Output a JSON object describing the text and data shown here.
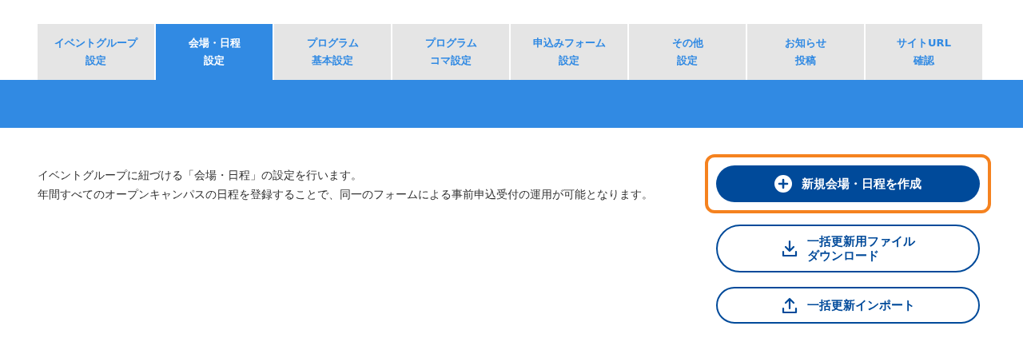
{
  "tabs": [
    {
      "lines": [
        "イベントグループ",
        "設定"
      ],
      "selected": false
    },
    {
      "lines": [
        "会場・日程",
        "設定"
      ],
      "selected": true
    },
    {
      "lines": [
        "プログラム",
        "基本設定"
      ],
      "selected": false
    },
    {
      "lines": [
        "プログラム",
        "コマ設定"
      ],
      "selected": false
    },
    {
      "lines": [
        "申込みフォーム",
        "設定"
      ],
      "selected": false
    },
    {
      "lines": [
        "その他",
        "設定"
      ],
      "selected": false
    },
    {
      "lines": [
        "お知らせ",
        "投稿"
      ],
      "selected": false
    },
    {
      "lines": [
        "サイトURL",
        "確認"
      ],
      "selected": false
    }
  ],
  "description": [
    "イベントグループに紐づける「会場・日程」の設定を行います。",
    "年間すべてのオープンキャンパスの日程を登録することで、同一のフォームによる事前申込受付の運用が可能となります。"
  ],
  "actions": [
    {
      "kind": "create",
      "lines": [
        "新規会場・日程を作成"
      ],
      "highlighted": true
    },
    {
      "kind": "download",
      "lines": [
        "一括更新用ファイル",
        "ダウンロード"
      ],
      "highlighted": false
    },
    {
      "kind": "upload",
      "lines": [
        "一括更新インポート"
      ],
      "highlighted": false
    }
  ]
}
